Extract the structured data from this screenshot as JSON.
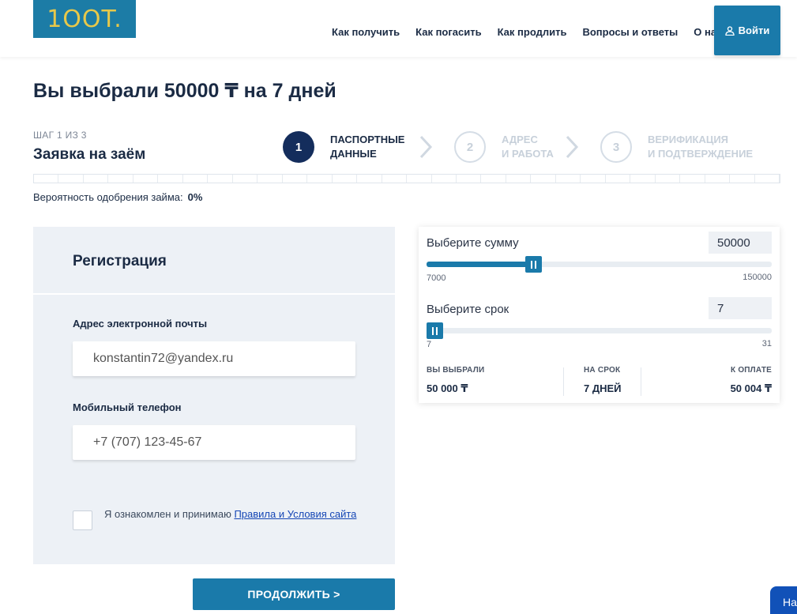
{
  "header": {
    "logo_text": "1OOT.",
    "nav": [
      "Как получить",
      "Как погасить",
      "Как продлить",
      "Вопросы и ответы",
      "О нас"
    ],
    "login_label": "Войти",
    "login_icon": "user-icon"
  },
  "page": {
    "title": "Вы выбрали 50000 ₸ на 7 дней"
  },
  "steps": {
    "counter": "ШАГ 1 ИЗ 3",
    "heading": "Заявка на заём",
    "items": [
      {
        "number": "1",
        "line1": "ПАСПОРТНЫЕ",
        "line2": "ДАННЫЕ",
        "active": true
      },
      {
        "number": "2",
        "line1": "АДРЕС",
        "line2": "И РАБОТА",
        "active": false
      },
      {
        "number": "3",
        "line1": "ВЕРИФИКАЦИЯ",
        "line2": "И ПОДТВЕРЖДЕНИЕ",
        "active": false
      }
    ],
    "progress_fraction": 0
  },
  "approval": {
    "label": "Вероятность одобрения займа:",
    "value": "0%"
  },
  "registration": {
    "title": "Регистрация",
    "email_label": "Адрес электронной почты",
    "email_value": "konstantin72@yandex.ru",
    "phone_label": "Мобильный телефон",
    "phone_value": "+7 (707) 123-45-67",
    "terms_text": "Я ознакомлен и принимаю ",
    "terms_link": "Правила и Условия сайта",
    "terms_checked": false
  },
  "continue_label": "ПРОДОЛЖИТЬ >",
  "calculator": {
    "amount_label": "Выберите сумму",
    "amount_value": "50000",
    "amount_min": "7000",
    "amount_max": "150000",
    "amount_fraction": 0.3,
    "term_label": "Выберите срок",
    "term_value": "7",
    "term_min": "7",
    "term_max": "31",
    "term_fraction": 0.0,
    "summary": [
      {
        "caption": "ВЫ ВЫБРАЛИ",
        "value": "50 000 ₸"
      },
      {
        "caption": "НА СРОК",
        "value": "7 ДНЕЙ"
      },
      {
        "caption": "К ОПЛАТЕ",
        "value": "50 004 ₸"
      }
    ]
  },
  "chat_label": "На",
  "colors": {
    "brand": "#1a7aaa",
    "dark": "#142d5c",
    "logo_gold": "#e7c84a"
  }
}
